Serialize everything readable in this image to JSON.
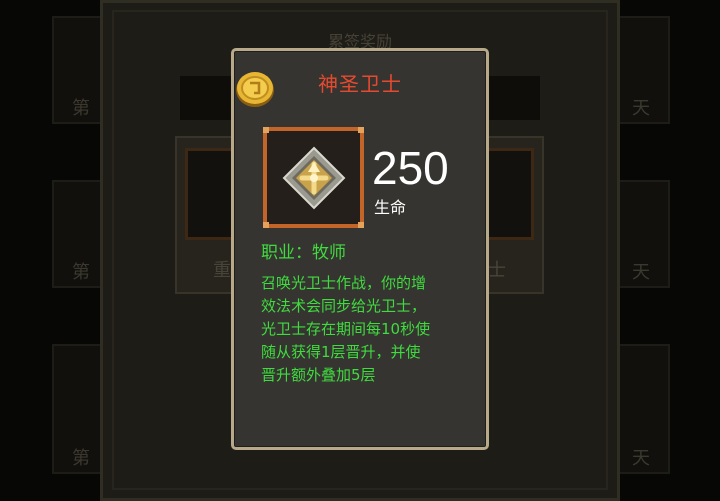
{
  "background": {
    "panel_title": "累签奖励",
    "left_card_labels": [
      "第",
      "第",
      "第"
    ],
    "right_card_labels": [
      "天",
      "天",
      "天"
    ],
    "left_slot_label": "重型",
    "right_slot_label": "卫士"
  },
  "popup": {
    "title": "神圣卫士",
    "stat_value": "250",
    "stat_label": "生命",
    "class_line": "职业：牧师",
    "description": "召唤光卫士作战，你的增\n效法术会同步给光卫士，\n光卫士存在期间每10秒使\n随从获得1层晋升，并使\n晋升额外叠加5层",
    "icons": {
      "coin": "gold-coin-icon",
      "item": "holy-guardian-emblem-icon"
    },
    "colors": {
      "title": "#e64a2e",
      "description": "#3fdc3f",
      "stat": "#ffffff",
      "frame": "#c36528",
      "border": "#b9a98b"
    }
  }
}
